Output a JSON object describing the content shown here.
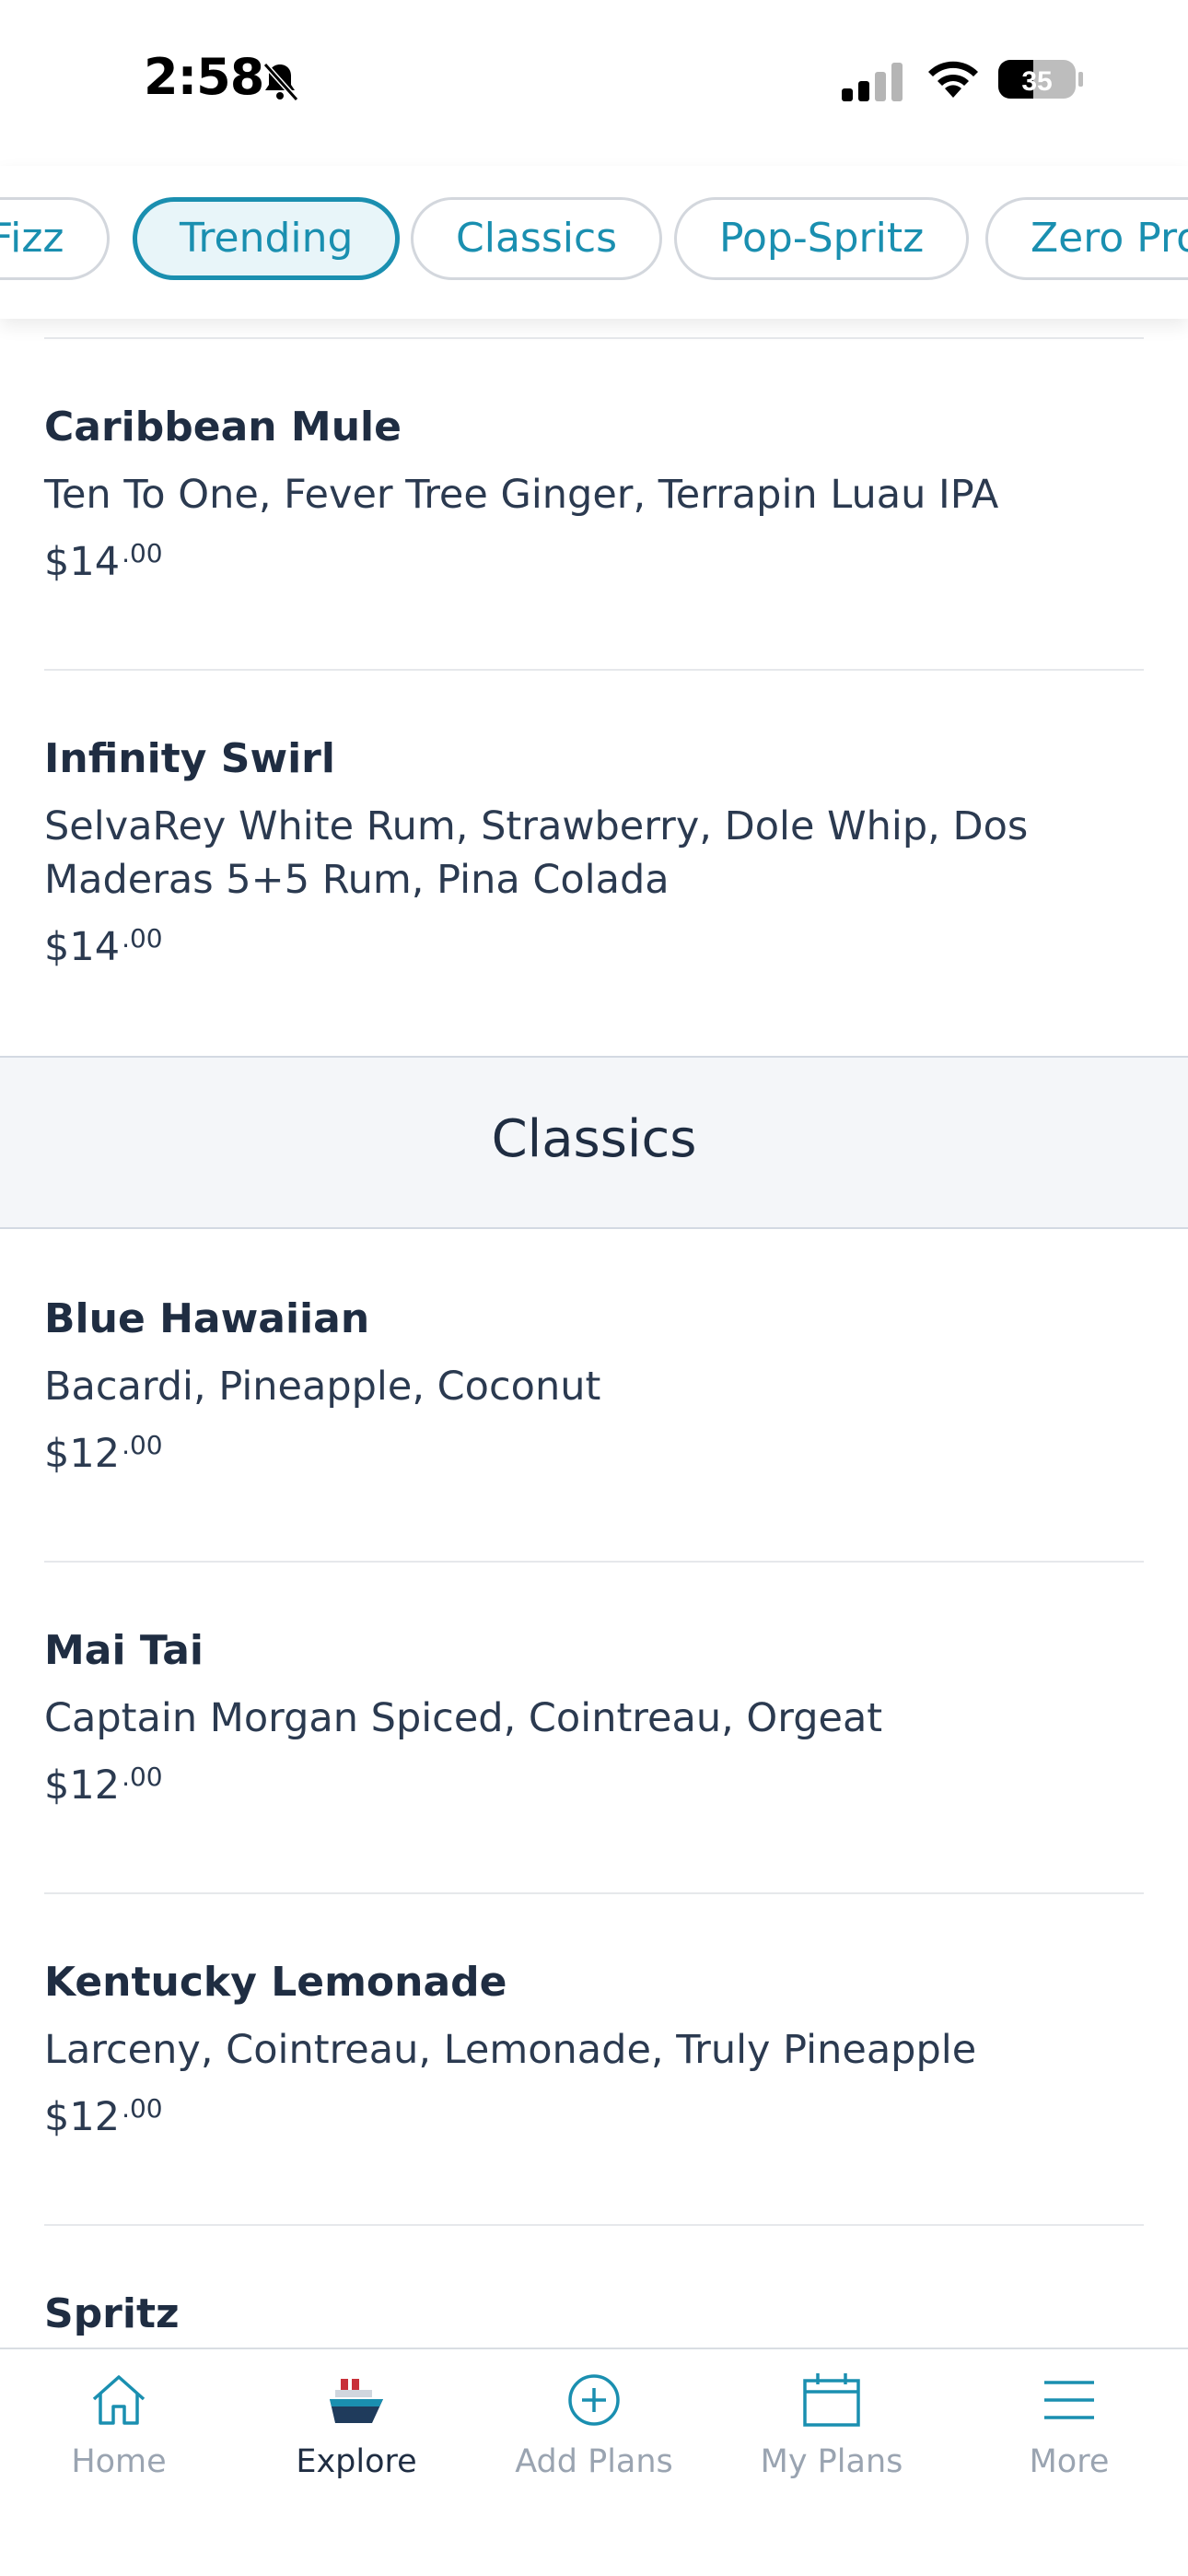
{
  "status_bar": {
    "time": "2:58",
    "battery": "35"
  },
  "chips": [
    {
      "label": "Fizz",
      "active": false
    },
    {
      "label": "Trending",
      "active": true
    },
    {
      "label": "Classics",
      "active": false
    },
    {
      "label": "Pop-Spritz",
      "active": false
    },
    {
      "label": "Zero Pro",
      "active": false
    }
  ],
  "trending_items": [
    {
      "name": "Caribbean Mule",
      "description": "Ten To One, Fever Tree Ginger, Terrapin Luau IPA",
      "price_dollars": "$14",
      "price_cents": ".00"
    },
    {
      "name": "Infinity Swirl",
      "description": "SelvaRey White Rum, Strawberry, Dole Whip, Dos Maderas 5+5 Rum, Pina Colada",
      "price_dollars": "$14",
      "price_cents": ".00"
    }
  ],
  "classics_section": {
    "title": "Classics",
    "items": [
      {
        "name": "Blue Hawaiian",
        "description": "Bacardi, Pineapple, Coconut",
        "price_dollars": "$12",
        "price_cents": ".00"
      },
      {
        "name": "Mai Tai",
        "description": "Captain Morgan Spiced, Cointreau, Orgeat",
        "price_dollars": "$12",
        "price_cents": ".00"
      },
      {
        "name": "Kentucky Lemonade",
        "description": "Larceny, Cointreau, Lemonade, Truly Pineapple",
        "price_dollars": "$12",
        "price_cents": ".00"
      },
      {
        "name": "Spritz"
      }
    ]
  },
  "tab_bar": [
    {
      "label": "Home",
      "icon": "home-icon",
      "active": false
    },
    {
      "label": "Explore",
      "icon": "ship-icon",
      "active": true
    },
    {
      "label": "Add Plans",
      "icon": "add-circle-icon",
      "active": false
    },
    {
      "label": "My Plans",
      "icon": "calendar-icon",
      "active": false
    },
    {
      "label": "More",
      "icon": "menu-icon",
      "active": false
    }
  ],
  "colors": {
    "accent": "#1a8fb0",
    "text": "#1f2d42",
    "inactive_tab": "#9aa4b1",
    "section_bg": "#f4f6f9"
  }
}
